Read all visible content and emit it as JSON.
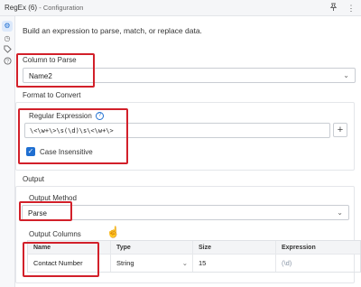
{
  "titlebar": {
    "title": "RegEx (6)",
    "subtitle": "- Configuration",
    "icons": [
      "pin-icon",
      "more-icon"
    ]
  },
  "rail": {
    "icons": [
      "settings-icon",
      "history-icon",
      "tag-icon",
      "help-icon"
    ],
    "active": "settings-icon"
  },
  "intro": "Build an expression to parse, match, or replace data.",
  "column_to_parse": {
    "label": "Column to Parse",
    "value": "Name2"
  },
  "format": {
    "label": "Format to Convert",
    "regex_label": "Regular Expression",
    "regex_value": "\\<\\w+\\>\\s(\\d)\\s\\<\\w+\\>",
    "plus_label": "+",
    "case_insensitive_label": "Case Insensitive",
    "case_insensitive": true
  },
  "output": {
    "label": "Output",
    "method_label": "Output Method",
    "method_value": "Parse",
    "columns_label": "Output Columns",
    "table": {
      "headers": [
        "Name",
        "Type",
        "Size",
        "Expression"
      ],
      "rows": [
        {
          "name": "Contact Number",
          "type": "String",
          "size": "15",
          "expression": "(\\d)"
        }
      ]
    }
  },
  "colors": {
    "highlight": "#d2202a",
    "accent": "#1f6fd1"
  }
}
